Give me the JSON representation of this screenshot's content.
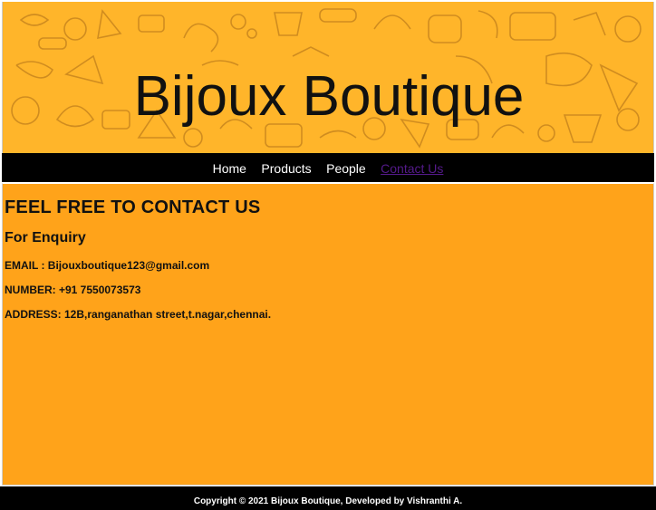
{
  "header": {
    "title": "Bijoux Boutique",
    "background_color": "#ffb52a",
    "pattern_color": "#c8861e"
  },
  "nav": {
    "items": [
      {
        "label": "Home",
        "state": "normal"
      },
      {
        "label": "Products",
        "state": "normal"
      },
      {
        "label": "People",
        "state": "normal"
      },
      {
        "label": "Contact Us",
        "state": "visited"
      }
    ],
    "background_color": "#000000",
    "visited_color": "#551a8b"
  },
  "main": {
    "heading": "FEEL FREE TO CONTACT US",
    "subheading": "For Enquiry",
    "email": "EMAIL : Bijouxboutique123@gmail.com",
    "number": "NUMBER: +91 7550073573",
    "address": "ADDRESS: 12B,ranganathan street,t.nagar,chennai.",
    "background_color": "#ffa31a"
  },
  "footer": {
    "text": "Copyright © 2021 Bijoux Boutique, Developed by Vishranthi A."
  }
}
